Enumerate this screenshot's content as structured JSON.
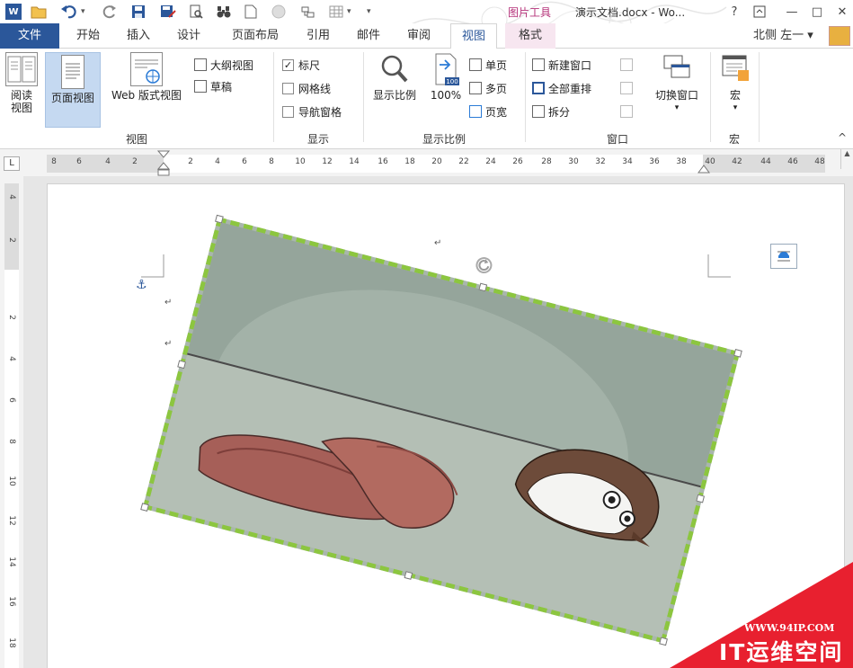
{
  "window": {
    "context_tool": "图片工具",
    "title": "演示文档.docx - Wo...",
    "help": "?",
    "minimize": "—",
    "maximize": "□",
    "close": "✕"
  },
  "quick_access": {
    "undo_icon": "undo-icon",
    "redo_icon": "redo-icon"
  },
  "tabs": [
    "文件",
    "开始",
    "插入",
    "设计",
    "页面布局",
    "引用",
    "邮件",
    "审阅",
    "视图",
    "格式"
  ],
  "active_tab": "视图",
  "user": {
    "name": "北侧 左一 ▾"
  },
  "ribbon": {
    "views": {
      "read_mode": "阅读\n视图",
      "read_mode_1": "阅读",
      "read_mode_2": "视图",
      "print_layout": "页面视图",
      "web_layout": "Web 版式视图",
      "outline": "大纲视图",
      "draft": "草稿",
      "label": "视图"
    },
    "show": {
      "ruler": "标尺",
      "ruler_checked": "✓",
      "gridlines": "网格线",
      "nav_pane": "导航窗格",
      "label": "显示"
    },
    "zoom": {
      "zoom": "显示比例",
      "hundred": "100%",
      "hundred_badge": "100",
      "one_page": "单页",
      "multi_page": "多页",
      "page_width": "页宽",
      "label": "显示比例"
    },
    "window": {
      "new_window": "新建窗口",
      "arrange_all": "全部重排",
      "split": "拆分",
      "switch_windows": "切换窗口",
      "switch_arrow": "▾",
      "label": "窗口"
    },
    "macros": {
      "macros": "宏",
      "macros_arrow": "▾",
      "label": "宏"
    },
    "collapse": "^"
  },
  "ruler": {
    "tab_selector": "L",
    "h_ticks": [
      "8",
      "6",
      "4",
      "2",
      "2",
      "4",
      "6",
      "8",
      "10",
      "12",
      "14",
      "16",
      "18",
      "20",
      "22",
      "24",
      "26",
      "28",
      "30",
      "32",
      "34",
      "36",
      "38",
      "40",
      "42",
      "44",
      "46",
      "48"
    ],
    "v_ticks": [
      "4",
      "2",
      "2",
      "4",
      "6",
      "8",
      "10",
      "12",
      "14",
      "16",
      "18"
    ]
  },
  "document": {
    "paragraph_mark": "↵",
    "anchor": "⚓"
  },
  "watermark": {
    "url": "WWW.94IP.COM",
    "brand": "IT运维空间"
  },
  "colors": {
    "word_blue": "#2b579a",
    "context_pink": "#b5337a",
    "selection_green": "#8cc63f",
    "watermark_red": "#e8202f"
  }
}
